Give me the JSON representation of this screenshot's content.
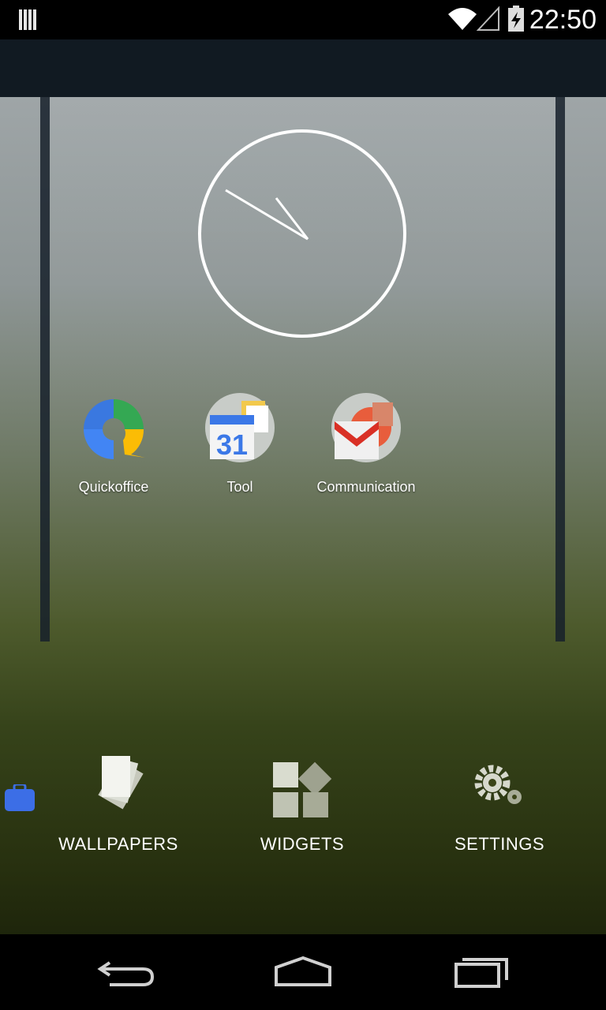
{
  "status_bar": {
    "time": "22:50",
    "icons": [
      "notification-icon",
      "wifi-icon",
      "cell-signal-icon",
      "battery-charging-icon"
    ]
  },
  "home": {
    "clock": {
      "type": "analog",
      "hour_hand": "10:50"
    },
    "apps": [
      {
        "label": "Quickoffice",
        "icon": "quickoffice-icon"
      },
      {
        "label": "Tool",
        "icon": "calendar-folder-icon"
      },
      {
        "label": "Communication",
        "icon": "gmail-folder-icon"
      }
    ]
  },
  "overview_menu": {
    "wallpapers": "WALLPAPERS",
    "widgets": "WIDGETS",
    "settings": "SETTINGS"
  },
  "calendar_day": "31",
  "nav_bar": [
    "back-icon",
    "home-icon",
    "recent-apps-icon"
  ]
}
